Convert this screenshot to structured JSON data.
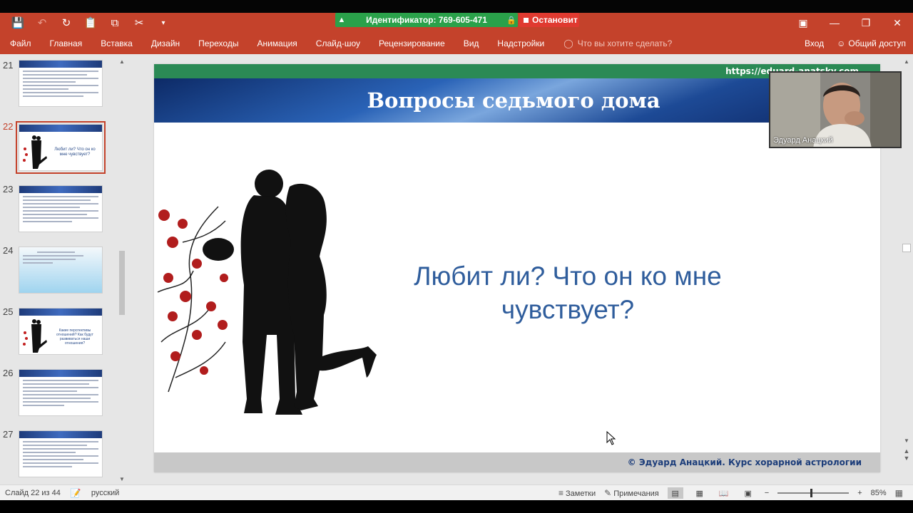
{
  "quick_access": {
    "icons": [
      "save-icon",
      "undo-icon",
      "redo-icon",
      "paste-icon",
      "copy-icon",
      "cut-icon",
      "customize-icon"
    ]
  },
  "zoom_meeting": {
    "id_label": "Идентификатор: 769-605-471",
    "stop_label": "Остановит",
    "accent": "#2aa14a",
    "stop_color": "#e03a30"
  },
  "ribbon": {
    "tabs": [
      "Файл",
      "Главная",
      "Вставка",
      "Дизайн",
      "Переходы",
      "Анимация",
      "Слайд-шоу",
      "Рецензирование",
      "Вид",
      "Надстройки"
    ],
    "tell_me": "Что вы хотите сделать?",
    "signin": "Вход",
    "share": "Общий доступ",
    "accent": "#c4422b"
  },
  "thumbnails": [
    {
      "number": "21",
      "selected": false
    },
    {
      "number": "22",
      "selected": true,
      "text": "Любит ли? Что он ко мне чувствует?"
    },
    {
      "number": "23",
      "selected": false
    },
    {
      "number": "24",
      "selected": false
    },
    {
      "number": "25",
      "selected": false,
      "text": "Какие перспективы отношений? Как будут развиваться наши отношения?"
    },
    {
      "number": "26",
      "selected": false
    },
    {
      "number": "27",
      "selected": false
    }
  ],
  "slide": {
    "url": "https://eduard-anatsky.com",
    "title": "Вопросы седьмого дома",
    "question": "Любит ли? Что он ко мне чувствует?",
    "footer": "© Эдуард Анацкий. Курс хорарной астрологии"
  },
  "webcam": {
    "name": "Эдуард Анацкий"
  },
  "status": {
    "slide_counter": "Слайд 22 из 44",
    "language": "русский",
    "notes": "Заметки",
    "comments": "Примечания",
    "zoom": "85%"
  }
}
